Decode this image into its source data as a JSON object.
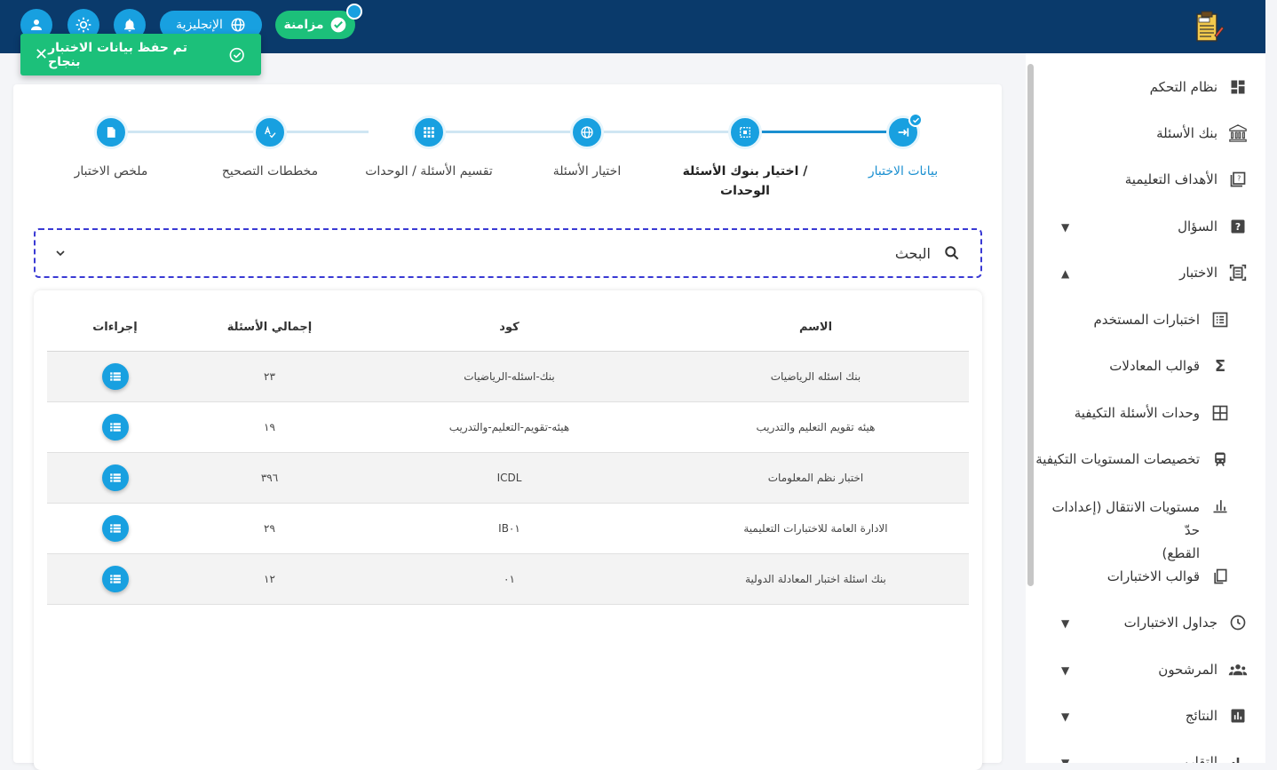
{
  "header": {
    "language_label": "الإنجليزية",
    "sync_label": "مزامنة",
    "icons": [
      "account-icon",
      "theme-icon",
      "bell-icon",
      "globe-icon",
      "check-circle-icon"
    ]
  },
  "toast": {
    "message": "تم حفظ بيانات الاختبار بنجاح"
  },
  "sidebar": {
    "items": [
      {
        "label": "نظام التحكم",
        "icon": "dashboard-icon"
      },
      {
        "label": "بنك الأسئلة",
        "icon": "bank-icon"
      },
      {
        "label": "الأهداف التعليمية",
        "icon": "objectives-icon"
      },
      {
        "label": "السؤال",
        "icon": "help-box-icon"
      },
      {
        "label": "الاختبار",
        "icon": "exam-icon"
      },
      {
        "label": "اختبارات المستخدم",
        "icon": "list-icon"
      },
      {
        "label": "قوالب المعادلات",
        "icon": "sigma-icon"
      },
      {
        "label": "وحدات الأسئلة التكيفية",
        "icon": "grid-icon"
      },
      {
        "label": "تخصيصات المستويات التكيفية",
        "icon": "train-icon"
      },
      {
        "label": "مستويات الانتقال (إعدادات حدّ",
        "label2": "القطع)",
        "icon": "bar-chart-icon"
      },
      {
        "label": "قوالب الاختبارات",
        "icon": "template-icon"
      },
      {
        "label": "جداول الاختبارات",
        "icon": "clock-icon"
      },
      {
        "label": "المرشحون",
        "icon": "people-icon"
      },
      {
        "label": "النتائج",
        "icon": "results-icon"
      },
      {
        "label": "التقارير",
        "icon": "reports-icon"
      }
    ]
  },
  "stepper": {
    "steps": [
      {
        "label": "بيانات الاختبار",
        "state": "done"
      },
      {
        "label": "اختيار بنوك الأسئلة /",
        "label2": "الوحدات",
        "state": "current"
      },
      {
        "label": "اختيار الأسئلة",
        "state": "pending"
      },
      {
        "label": "تقسيم الأسئلة / الوحدات",
        "state": "pending"
      },
      {
        "label": "مخططات التصحيح",
        "state": "pending"
      },
      {
        "label": "ملخص الاختبار",
        "state": "pending"
      }
    ]
  },
  "search": {
    "label": "البحث"
  },
  "table": {
    "headers": {
      "name": "الاسم",
      "code": "كود",
      "total": "إجمالي الأسئلة",
      "actions": "إجراءات"
    },
    "rows": [
      {
        "name": "بنك اسئله الرياضيات",
        "code": "بنك-اسئله-الرياضيات",
        "total": "٢٣"
      },
      {
        "name": "هيئه تقويم التعليم والتدريب",
        "code": "هيئه-تقويم-التعليم-والتدريب",
        "total": "١٩"
      },
      {
        "name": "اختبار نظم المعلومات",
        "code": "ICDL",
        "total": "٣٩٦"
      },
      {
        "name": "الادارة العامة للاختبارات التعليمية",
        "code": "IB٠١",
        "total": "٢٩"
      },
      {
        "name": "بنك اسئلة اختبار المعادلة الدولية",
        "code": "٠١",
        "total": "١٢"
      }
    ]
  },
  "colors": {
    "header": "#0a3a6b",
    "accent": "#18a0e0",
    "success": "#1cc07a",
    "focus_border": "#3a3ad4"
  }
}
